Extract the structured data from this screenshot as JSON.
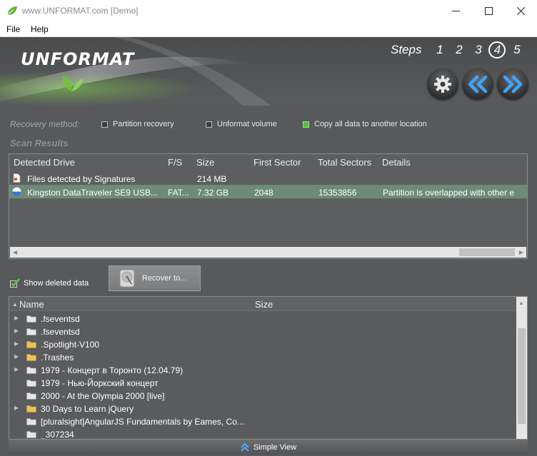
{
  "window": {
    "title": "www.UNFORMAT.com [Demo]",
    "controls": [
      "minimize-icon",
      "maximize-icon",
      "close-icon"
    ]
  },
  "menu": {
    "file": "File",
    "help": "Help"
  },
  "header": {
    "logo": "UNFORMAT",
    "steps_label": "Steps",
    "steps": [
      "1",
      "2",
      "3",
      "4",
      "5"
    ],
    "active_step": "4",
    "buttons": [
      "gear-icon",
      "back-icon",
      "next-icon"
    ]
  },
  "recovery": {
    "label": "Recovery method:",
    "options": [
      {
        "label": "Partition recovery",
        "selected": false
      },
      {
        "label": "Unformat volume",
        "selected": false
      },
      {
        "label": "Copy all data to another location",
        "selected": true
      }
    ]
  },
  "scan": {
    "title": "Scan Results",
    "columns": [
      "Detected Drive",
      "F/S",
      "Size",
      "First Sector",
      "Total Sectors",
      "Details"
    ],
    "rows": [
      {
        "icon": "signature-file-icon",
        "drive": "Files detected by Signatures",
        "fs": "",
        "size": "214 MB",
        "first": "",
        "total": "",
        "details": ""
      },
      {
        "icon": "usb-drive-icon",
        "drive": "Kingston DataTraveler SE9 USB...",
        "fs": "FAT...",
        "size": "7.32 GB",
        "first": "2048",
        "total": "15353856",
        "details": "Partition is overlapped with other e",
        "selected": true
      }
    ]
  },
  "options": {
    "show_deleted": "Show deleted data",
    "show_deleted_checked": true,
    "recover_button": "Recover to..."
  },
  "tree": {
    "columns": [
      "Name",
      "Size"
    ],
    "items": [
      {
        "name": ".fseventsd",
        "expandable": true,
        "color": "#e6e6e6"
      },
      {
        "name": ".fseventsd",
        "expandable": true,
        "color": "#e6e6e6"
      },
      {
        "name": ".Spotlight-V100",
        "expandable": true,
        "color": "#f2c24b"
      },
      {
        "name": ".Trashes",
        "expandable": true,
        "color": "#f2c24b"
      },
      {
        "name": "1979 - Концерт в Торонто (12.04.79)",
        "expandable": true,
        "color": "#e6e6e6"
      },
      {
        "name": "1979 - Нью-Йоркский концерт",
        "expandable": false,
        "color": "#e6e6e6"
      },
      {
        "name": "2000 - At the Olympia 2000 [live]",
        "expandable": false,
        "color": "#e6e6e6"
      },
      {
        "name": "30 Days to Learn jQuery",
        "expandable": true,
        "color": "#f2c24b"
      },
      {
        "name": "[pluralsight]AngularJS Fundamentals by Eames, Co...",
        "expandable": false,
        "color": "#e6e6e6"
      },
      {
        "name": "_307234",
        "expandable": false,
        "color": "#e6e6e6"
      }
    ]
  },
  "footer": {
    "simple_view": "Simple View"
  }
}
